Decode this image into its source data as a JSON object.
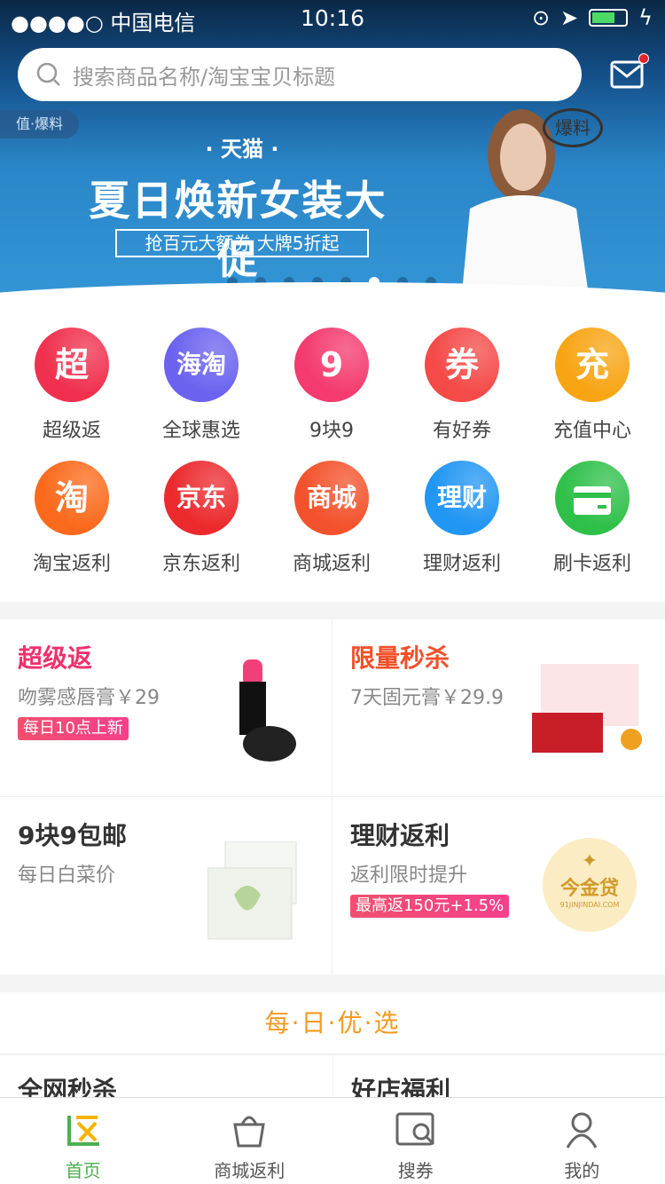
{
  "status": {
    "carrier": "●●●●○ 中国电信",
    "time": "10:16"
  },
  "search": {
    "placeholder": "搜索商品名称/淘宝宝贝标题"
  },
  "banner": {
    "tag": "值·爆料",
    "brand": "· 天猫 ·",
    "headline": "夏日焕新女装大促",
    "sub": "抢百元大额券 大牌5折起",
    "stamp": "爆料",
    "slide_count": 8,
    "active_slide": 6
  },
  "shortcuts": [
    {
      "label": "超级返",
      "glyph": "超",
      "color": "#f0304e"
    },
    {
      "label": "全球惠选",
      "glyph": "海淘",
      "color": "#6b63f0"
    },
    {
      "label": "9块9",
      "glyph": "9",
      "color": "#f43a6e"
    },
    {
      "label": "有好券",
      "glyph": "券",
      "color": "#f44a48"
    },
    {
      "label": "充值中心",
      "glyph": "充",
      "color": "#f8a514"
    },
    {
      "label": "淘宝返利",
      "glyph": "淘",
      "color": "#fb6a1c"
    },
    {
      "label": "京东返利",
      "glyph": "京东",
      "color": "#ec2a2e"
    },
    {
      "label": "商城返利",
      "glyph": "商城",
      "color": "#f3522c"
    },
    {
      "label": "理财返利",
      "glyph": "理财",
      "color": "#2196f3"
    },
    {
      "label": "刷卡返利",
      "glyph": "card",
      "color": "#2fc04a"
    }
  ],
  "cards": [
    {
      "title": "超级返",
      "title_color": "#f0306c",
      "desc": "吻雾感唇膏￥29",
      "pill": "每日10点上新"
    },
    {
      "title": "限量秒杀",
      "title_color": "#f3502a",
      "desc": "7天固元膏￥29.9",
      "pill": ""
    },
    {
      "title": "9块9包邮",
      "title_color": "#333333",
      "desc": "每日白菜价",
      "pill": ""
    },
    {
      "title": "理财返利",
      "title_color": "#333333",
      "desc": "返利限时提升",
      "pill": "最高返150元+1.5%",
      "logo": "今金贷",
      "logo_sub": "91JINJINDAI.COM"
    }
  ],
  "daily": {
    "title": "每·日·优·选"
  },
  "more": [
    "全网秒杀",
    "好店福利"
  ],
  "tabs": [
    {
      "label": "首页",
      "active": true
    },
    {
      "label": "商城返利"
    },
    {
      "label": "搜券"
    },
    {
      "label": "我的"
    }
  ]
}
